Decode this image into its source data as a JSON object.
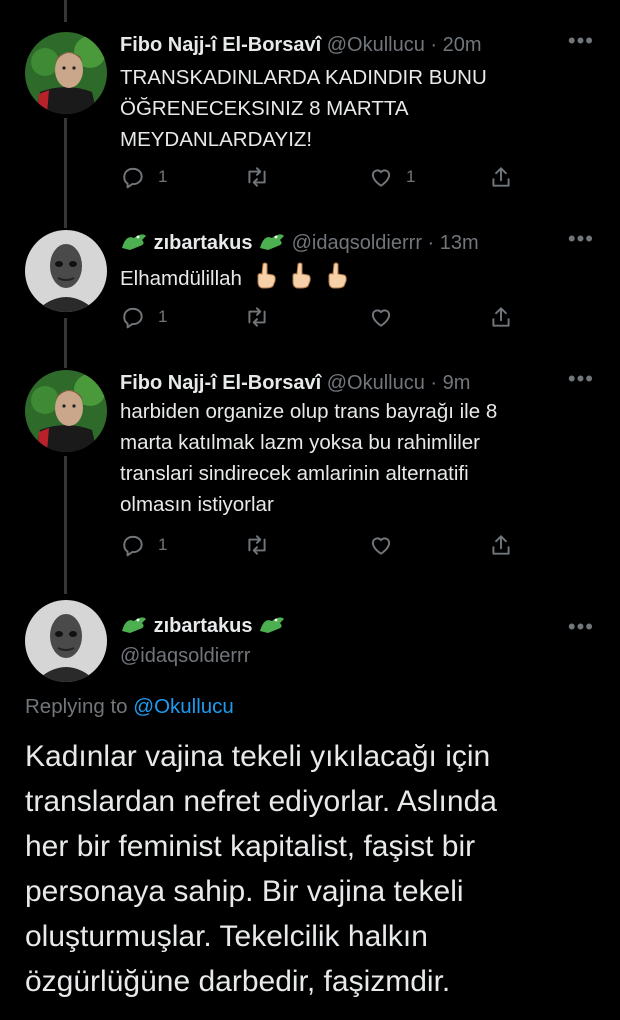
{
  "tweets": [
    {
      "name": "Fibo Najj-î El-Borsavî",
      "handle": "@Okullucu",
      "time": "20m",
      "text_lines": [
        "TRANSKADINLARDA KADINDIR BUNU",
        "ÖĞRENECEKSINIZ 8 MARTTA",
        "MEYDANLARDAYIZ!"
      ],
      "replies": "1",
      "retweets": "",
      "likes": "1",
      "avatar_colors": {
        "bg": "#2e6b2a",
        "face": "#caa68a"
      }
    },
    {
      "name": "zıbartakus",
      "handle": "@idaqsoldierrr",
      "time": "13m",
      "text": "Elhamdülillah",
      "replies": "1",
      "retweets": "",
      "likes": "",
      "avatar_colors": {
        "bg": "#c9c9c9",
        "face": "#444"
      }
    },
    {
      "name": "Fibo Najj-î El-Borsavî",
      "handle": "@Okullucu",
      "time": "9m",
      "text_lines": [
        "harbiden organize olup trans bayrağı ile 8",
        "marta katılmak lazm yoksa bu rahimliler",
        "translari sindirecek amlarinin alternatifi",
        "olmasın istiyorlar"
      ],
      "replies": "1",
      "retweets": "",
      "likes": ""
    }
  ],
  "main": {
    "name": "zıbartakus",
    "handle": "@idaqsoldierrr",
    "replying_prefix": "Replying to",
    "replying_to": "@Okullucu",
    "text_lines": [
      "Kadınlar vajina tekeli yıkılacağı için",
      "translardan nefret ediyorlar. Aslında",
      "her bir feminist kapitalist, faşist bir",
      "personaya sahip. Bir vajina tekeli",
      "oluşturmuşlar. Tekelcilik halkın",
      "özgürlüğüne darbedir, faşizmdir."
    ]
  },
  "ui": {
    "more": "•••",
    "dot": "·"
  },
  "colors": {
    "background": "#000000",
    "text": "#e7e9ea",
    "muted": "#71767b",
    "link": "#1d9bf0",
    "croc": "#4caf50"
  }
}
